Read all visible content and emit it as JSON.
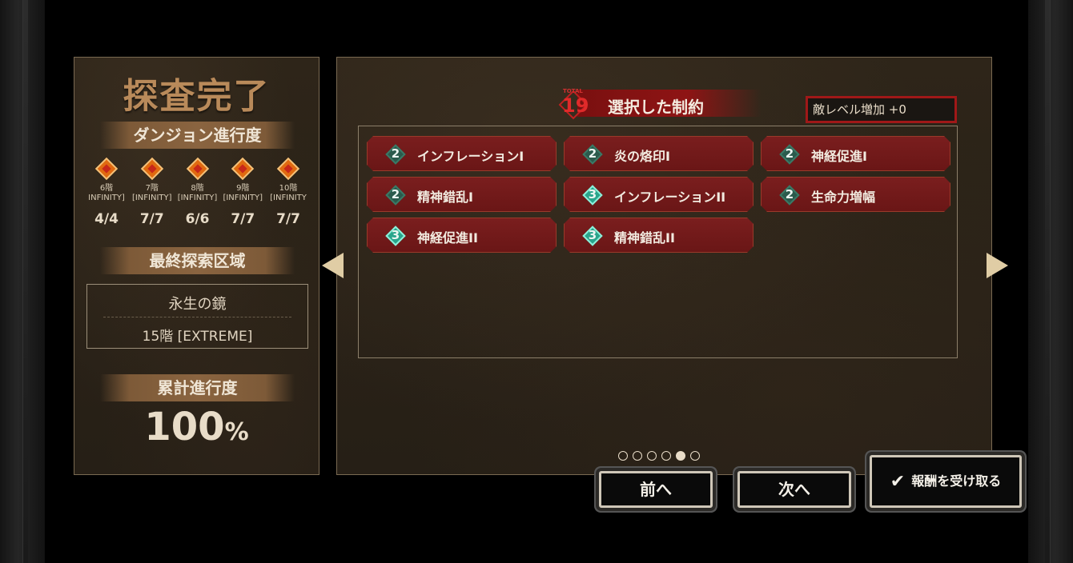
{
  "left_panel": {
    "title": "探査完了",
    "dungeon_progress_label": "ダンジョン進行度",
    "floors": [
      {
        "floor": "6階",
        "mode": "INFINITY]",
        "count": "4/4"
      },
      {
        "floor": "7階",
        "mode": "[INFINITY]",
        "count": "7/7"
      },
      {
        "floor": "8階",
        "mode": "[INFINITY]",
        "count": "6/6"
      },
      {
        "floor": "9階",
        "mode": "[INFINITY]",
        "count": "7/7"
      },
      {
        "floor": "10階",
        "mode": "[INFINITY",
        "count": "7/7"
      }
    ],
    "last_area_label": "最終探索区域",
    "last_area_name": "永生の鏡",
    "last_area_floor": "15階 [EXTREME]",
    "cumulative_label": "累計進行度",
    "cumulative_value": "100",
    "cumulative_unit": "%"
  },
  "right_panel": {
    "total_small": "TOTAL",
    "total_value": "19",
    "section_title": "選択した制約",
    "enemy_level": "敵レベル増加 +0",
    "constraints": [
      {
        "level": "2",
        "label": "インフレーションI",
        "tier": "l2"
      },
      {
        "level": "2",
        "label": "炎の烙印I",
        "tier": "l2"
      },
      {
        "level": "2",
        "label": "神経促進I",
        "tier": "l2"
      },
      {
        "level": "2",
        "label": "精神錯乱I",
        "tier": "l2"
      },
      {
        "level": "3",
        "label": "インフレーションII",
        "tier": "l3"
      },
      {
        "level": "2",
        "label": "生命力増幅",
        "tier": "l2"
      },
      {
        "level": "3",
        "label": "神経促進II",
        "tier": "l3"
      },
      {
        "level": "3",
        "label": "精神錯乱II",
        "tier": "l3"
      }
    ]
  },
  "pagination": {
    "total": 6,
    "active": 5
  },
  "buttons": {
    "prev": "前へ",
    "next": "次へ",
    "claim": "報酬を受け取る"
  },
  "colors": {
    "constraint_bg": "#6a1616",
    "accent_red": "#a01818",
    "gem_teal": "#2aa58c"
  },
  "icons": {
    "claim_button_icon": "check-icon",
    "prev_page": "triangle-left-icon",
    "next_page": "triangle-right-icon"
  }
}
